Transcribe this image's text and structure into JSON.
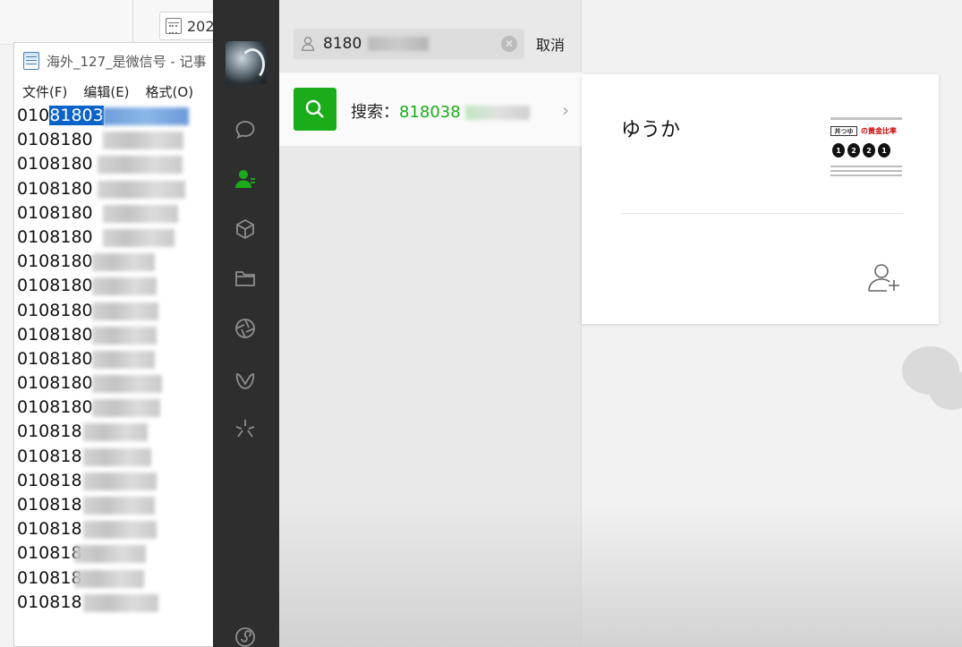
{
  "background_app": {
    "date_text": "202"
  },
  "notepad": {
    "title": "海外_127_是微信号 - 记事",
    "menu": [
      "文件(F)",
      "编辑(E)",
      "格式(O)"
    ],
    "selected_prefix": "010",
    "selected_text": "81803",
    "lines": [
      "0108180",
      "0108180",
      "0108180",
      "0108180",
      "0108180",
      "0108180",
      "0108180",
      "0108180",
      "0108180",
      "0108180",
      "0108180",
      "0108180",
      "010818",
      "010818",
      "010818",
      "010818",
      "010818",
      "010818",
      "010818",
      "010818"
    ]
  },
  "sidebar": {
    "icons": [
      "chat-icon",
      "contacts-icon",
      "box-icon",
      "folder-icon",
      "moments-icon",
      "channels-icon",
      "sparkle-icon",
      "mini-program-icon"
    ]
  },
  "search": {
    "query": "8180",
    "cancel_label": "取消",
    "result_prefix": "搜索：",
    "result_query": "818038"
  },
  "profile": {
    "name": "ゆうか",
    "thumbnail": {
      "box_text": "丼つゆ",
      "headline": "の黄金比率",
      "circle_labels": [
        "1",
        "2",
        "2",
        "1"
      ]
    }
  },
  "colors": {
    "wechat_green": "#1aad19",
    "sidebar": "#2e2e2e",
    "selection": "#0a63c8"
  }
}
